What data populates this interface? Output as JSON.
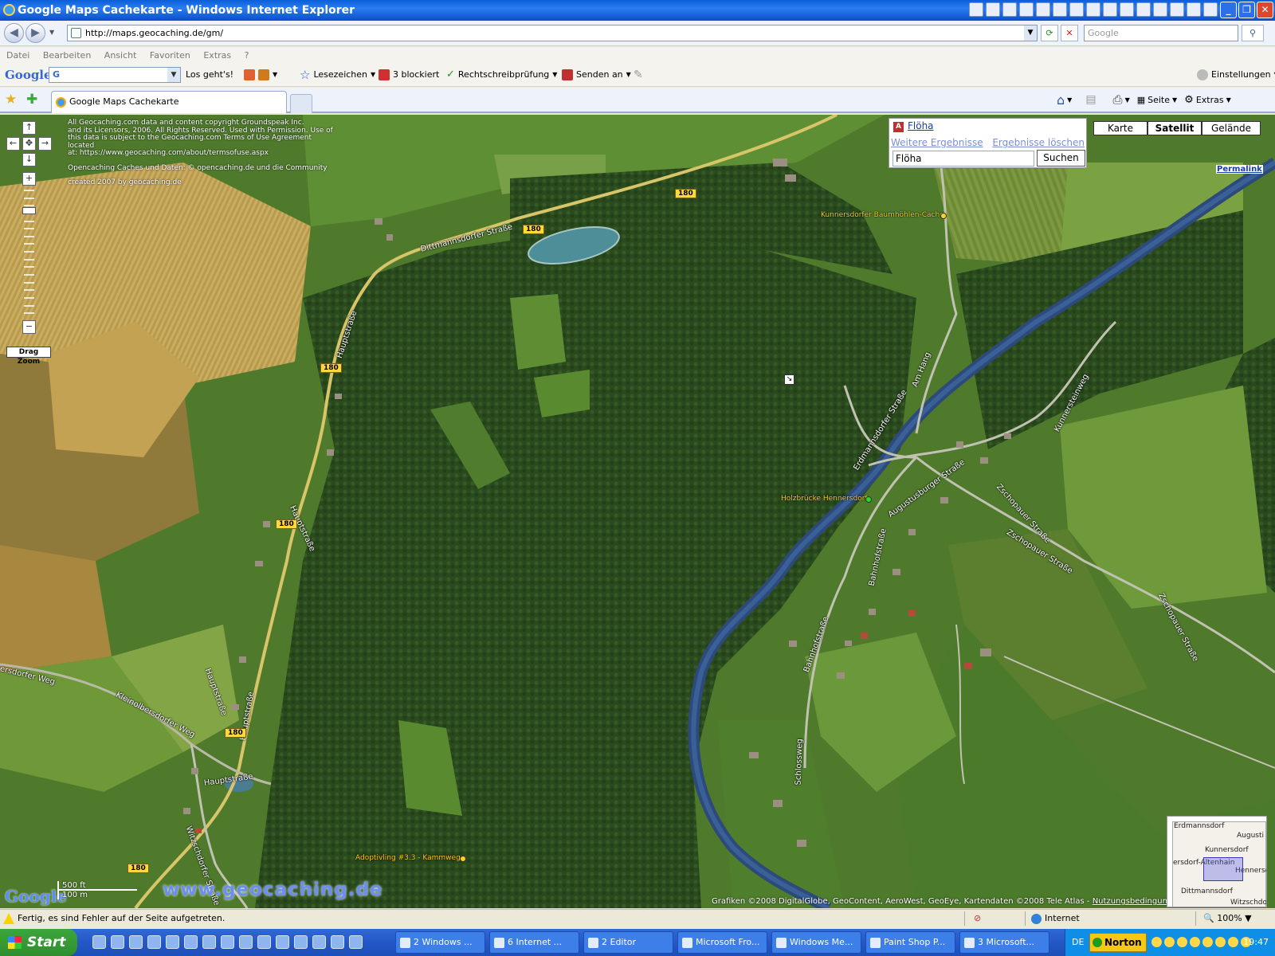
{
  "window": {
    "title": "Google Maps Cachekarte - Windows Internet Explorer"
  },
  "address": {
    "url": "http://maps.geocaching.de/gm/",
    "search_placeholder": "Google"
  },
  "menu": [
    "Datei",
    "Bearbeiten",
    "Ansicht",
    "Favoriten",
    "Extras",
    "?"
  ],
  "google_toolbar": {
    "logo": "Google",
    "go": "Los geht's!",
    "bookmarks": "Lesezeichen",
    "blocked": "3 blockiert",
    "spellcheck": "Rechtschreibprüfung",
    "send": "Senden an",
    "settings": "Einstellungen"
  },
  "tabs": [
    {
      "label": "Google Maps Cachekarte"
    }
  ],
  "command_bar": {
    "page": "Seite",
    "extras": "Extras"
  },
  "map": {
    "copyright": [
      "All Geocaching.com data and content copyright Groundspeak Inc.",
      "and its Licensors, 2006. All Rights Reserved. Used with Permission. Use of",
      "this data is subject to the Geocaching.com Terms of Use Agreement located",
      "at: https://www.geocaching.com/about/termsofuse.aspx"
    ],
    "opencaching": "Opencaching Caches und Daten: © opencaching.de und die Community",
    "created": "created 2007 by geocaching.de",
    "drag_zoom": "Drag Zoom",
    "search": {
      "marker": "A",
      "result": "Flöha",
      "more": "Weitere Ergebnisse",
      "clear": "Ergebnisse löschen",
      "query": "Flöha",
      "button": "Suchen"
    },
    "types": [
      {
        "label": "Karte",
        "active": false
      },
      {
        "label": "Satellit",
        "active": true
      },
      {
        "label": "Gelände",
        "active": false
      }
    ],
    "permalink": "Permalink",
    "caches": [
      {
        "name": "Kunnersdorfer Baumhöhlen-Cache",
        "color": "#ffd21a"
      },
      {
        "name": "Holzbrücke Hennersdorf",
        "color": "#22dd22"
      },
      {
        "name": "Adoptivling #3.3 - Kammweg",
        "color": "#ffd21a"
      }
    ],
    "roads": {
      "dittmannsdorfer": "Dittmannsdorfer Straße",
      "haupt": "Hauptstraße",
      "am_hang": "Am Hang",
      "erdmannsdorfer": "Erdmannsdorfer Straße",
      "augustusburger": "Augustusburger Straße",
      "kunnerstein": "Kunnersteinweg",
      "zschopauer": "Zschopauer Straße",
      "bahnhof": "Bahnhofstraße",
      "schloss": "Schlossweg",
      "kleinolbersdorfer": "Kleinolbersdorfer Weg",
      "olbersdorfer": "ersdorfer Weg",
      "witzschdorfer": "Witzschdorfer Straße",
      "b180": "180"
    },
    "watermark": "www.geocaching.de",
    "google_logo": "Google",
    "scale": {
      "ft": "500 ft",
      "m": "100 m"
    },
    "attribution": "Grafiken ©2008 DigitalGlobe, GeoContent, AeroWest, GeoEye, Kartendaten ©2008 Tele Atlas - ",
    "terms": "Nutzungsbedingungen",
    "overview": [
      "Erdmannsdorf",
      "Augusti",
      "Kunnersdorf",
      "ersdorf-Altenhain",
      "Hennersdo",
      "Dittmannsdorf",
      "Witzschdo"
    ]
  },
  "status": {
    "message": "Fertig, es sind Fehler auf der Seite aufgetreten.",
    "zone": "Internet",
    "zoom": "100%"
  },
  "taskbar": {
    "start": "Start",
    "buttons": [
      "2 Windows ...",
      "6 Internet ...",
      "2 Editor",
      "Microsoft Fro...",
      "Windows Me...",
      "Paint Shop P...",
      "3 Microsoft..."
    ],
    "lang": "DE",
    "norton": "Norton",
    "clock": "19:47"
  }
}
